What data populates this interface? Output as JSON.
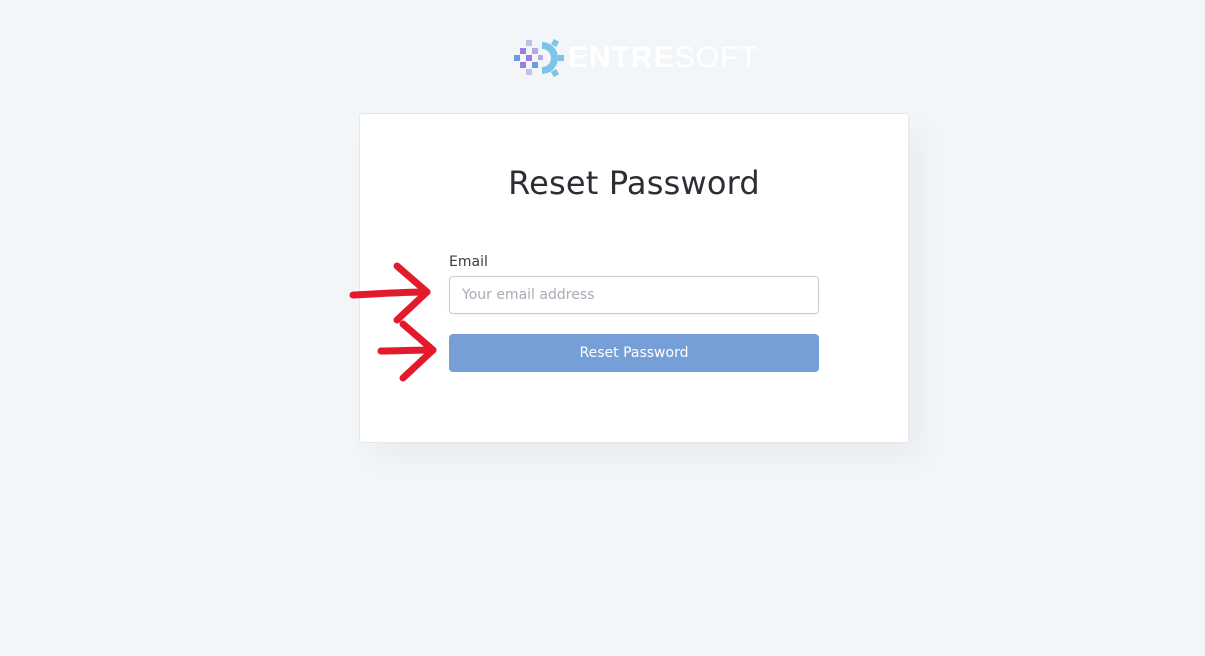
{
  "logo": {
    "text_bold": "ENTRE",
    "text_light": "SOFT",
    "colors": {
      "gear": "#7cc4ea",
      "pixel_purple": "#9b7fe0",
      "pixel_blue": "#6e9ae0",
      "pixel_light": "#c8b9f0"
    }
  },
  "card": {
    "title": "Reset Password",
    "email_label": "Email",
    "email_placeholder": "Your email address",
    "email_value": "",
    "submit_label": "Reset Password"
  },
  "annotations": {
    "arrow_color": "#e3192c",
    "arrows": [
      "email-field",
      "submit-button"
    ]
  },
  "colors": {
    "background": "#f3f6f9",
    "button": "#759fd6",
    "title": "#2b2e33"
  }
}
